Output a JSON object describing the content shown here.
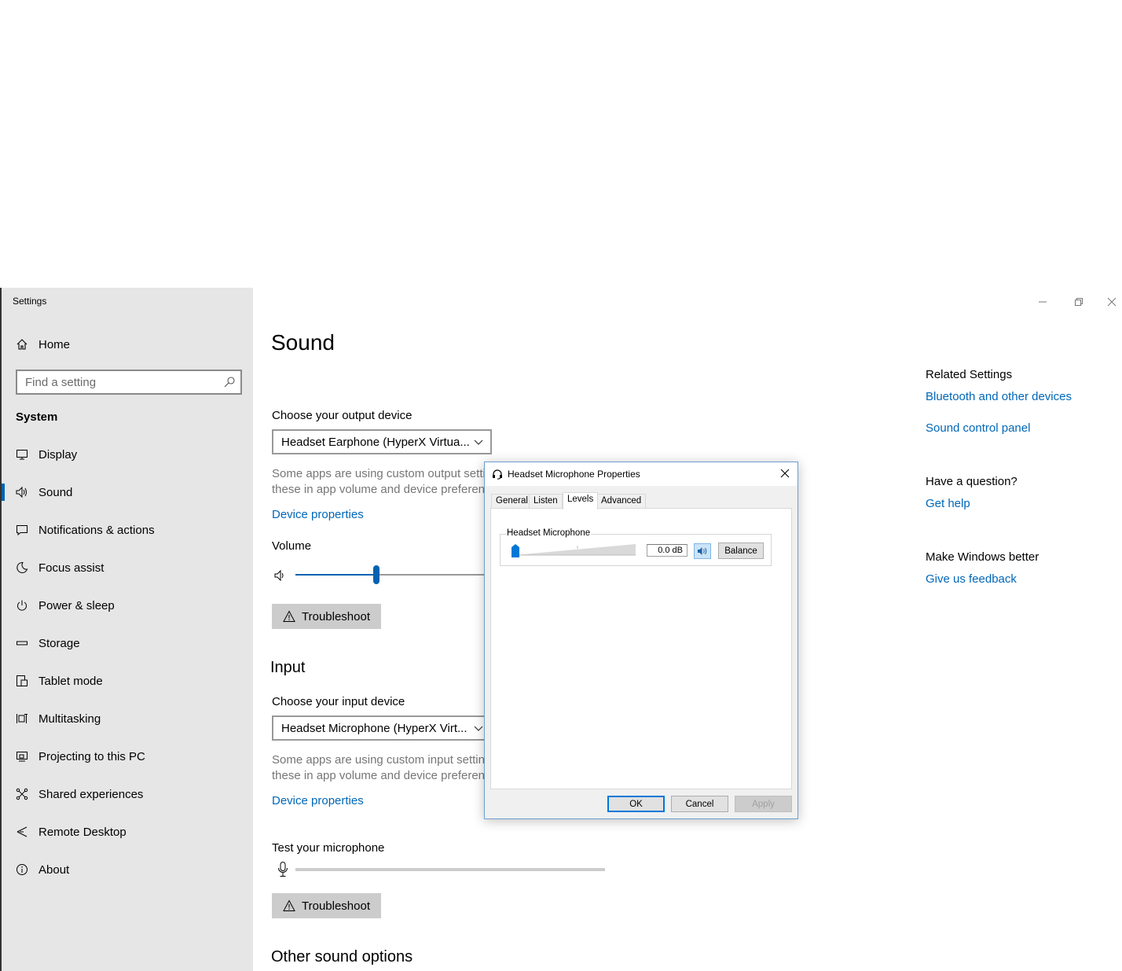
{
  "window": {
    "app_title": "Settings",
    "controls": {
      "minimize": "minimize-icon",
      "restore": "restore-icon",
      "close": "close-icon"
    }
  },
  "sidebar": {
    "home_label": "Home",
    "search_placeholder": "Find a setting",
    "section_label": "System",
    "items": [
      {
        "label": "Display",
        "icon": "display-icon"
      },
      {
        "label": "Sound",
        "icon": "speaker-icon",
        "selected": true
      },
      {
        "label": "Notifications & actions",
        "icon": "notification-icon"
      },
      {
        "label": "Focus assist",
        "icon": "moon-icon"
      },
      {
        "label": "Power & sleep",
        "icon": "power-icon"
      },
      {
        "label": "Storage",
        "icon": "storage-icon"
      },
      {
        "label": "Tablet mode",
        "icon": "tablet-icon"
      },
      {
        "label": "Multitasking",
        "icon": "multitasking-icon"
      },
      {
        "label": "Projecting to this PC",
        "icon": "projecting-icon"
      },
      {
        "label": "Shared experiences",
        "icon": "shared-icon"
      },
      {
        "label": "Remote Desktop",
        "icon": "remote-desktop-icon"
      },
      {
        "label": "About",
        "icon": "info-icon"
      }
    ],
    "accent_color": "#0063b1"
  },
  "main": {
    "title": "Sound",
    "output": {
      "label": "Choose your output device",
      "device": "Headset Earphone (HyperX Virtua...",
      "note_line1": "Some apps are using custom output setti",
      "note_line2": "these in app volume and device preferen",
      "device_properties": "Device properties",
      "volume_label": "Volume",
      "volume_level_fraction": 0.27,
      "troubleshoot": "Troubleshoot"
    },
    "input": {
      "heading": "Input",
      "label": "Choose your input device",
      "device": "Headset Microphone (HyperX Virt...",
      "note_line1": "Some apps are using custom input settin",
      "note_line2": "these in app volume and device preferen",
      "device_properties": "Device properties",
      "test_label": "Test your microphone",
      "troubleshoot": "Troubleshoot"
    },
    "other_heading": "Other sound options"
  },
  "related": {
    "heading": "Related Settings",
    "links": [
      "Bluetooth and other devices",
      "Sound control panel"
    ],
    "question_heading": "Have a question?",
    "help_link": "Get help",
    "better_heading": "Make Windows better",
    "feedback_link": "Give us feedback"
  },
  "dialog": {
    "title": "Headset Microphone Properties",
    "tabs": [
      "General",
      "Listen",
      "Levels",
      "Advanced"
    ],
    "active_tab": "Levels",
    "group_label": "Headset Microphone",
    "level_value": "0.0 dB",
    "level_fraction": 0.0,
    "balance_button": "Balance",
    "ok": "OK",
    "cancel": "Cancel",
    "apply": "Apply"
  }
}
